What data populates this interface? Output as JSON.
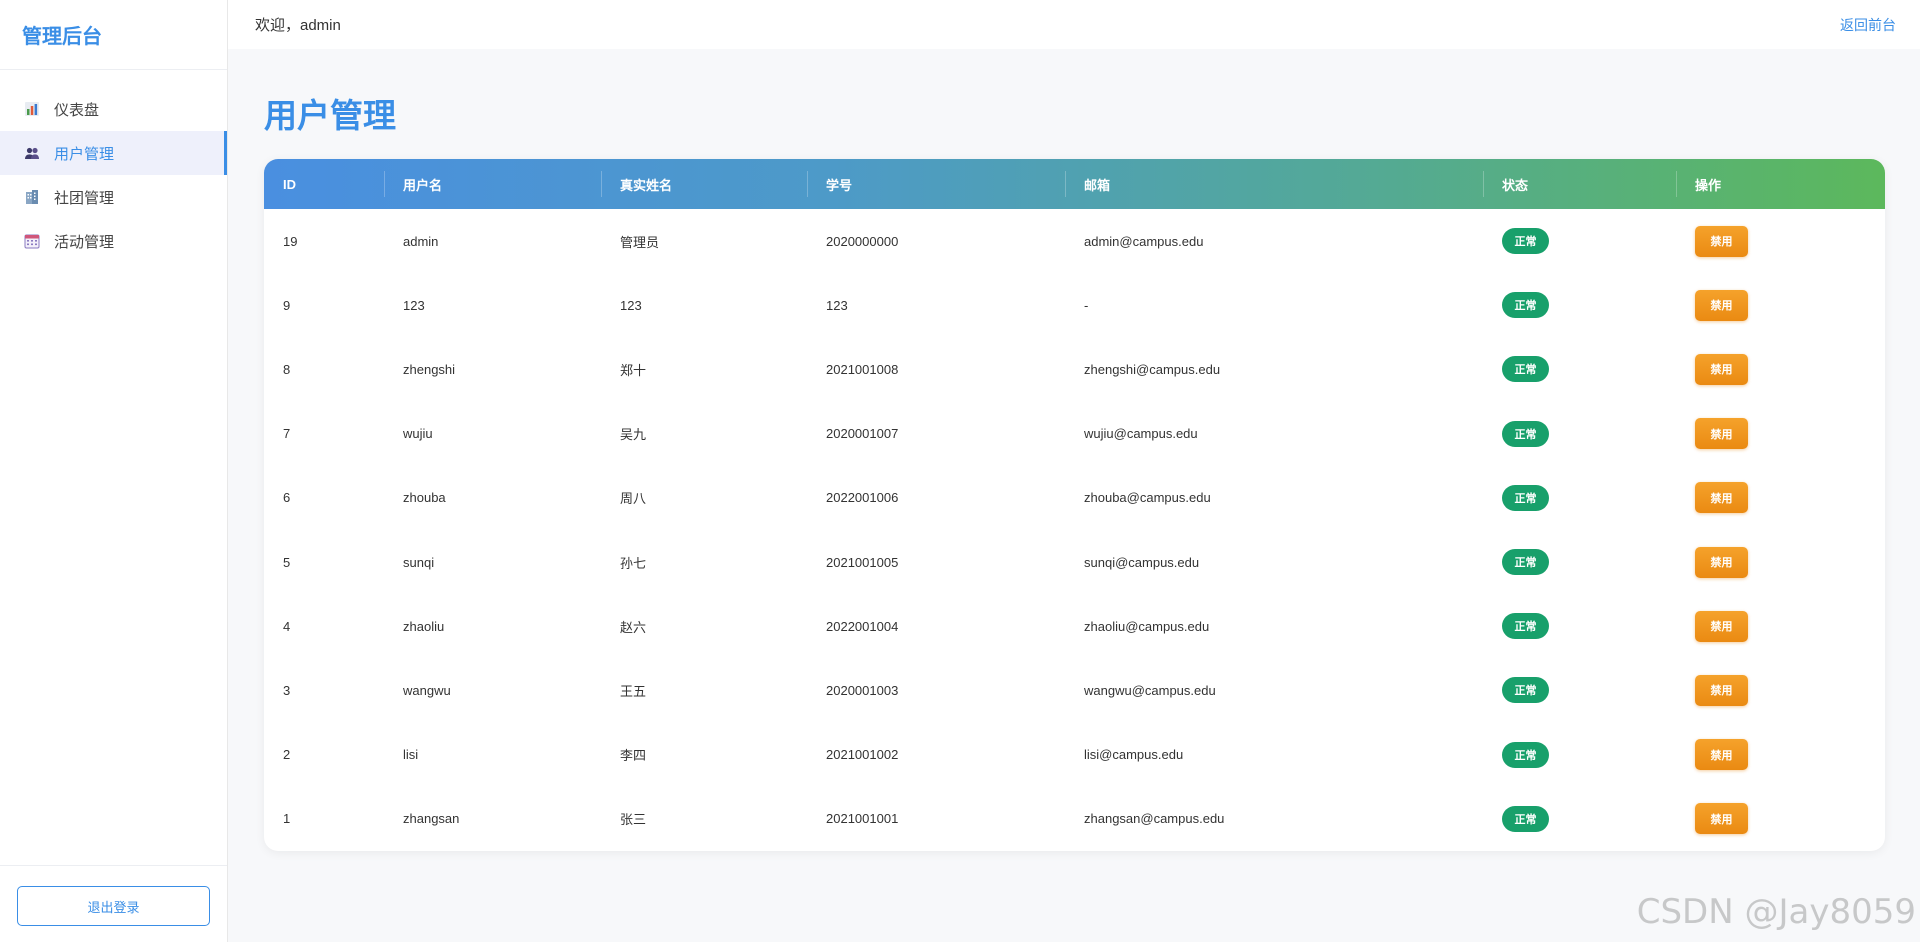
{
  "sidebar": {
    "brand": "管理后台",
    "items": [
      {
        "label": "仪表盘",
        "icon": "bar-chart-icon",
        "active": false
      },
      {
        "label": "用户管理",
        "icon": "users-icon",
        "active": true
      },
      {
        "label": "社团管理",
        "icon": "building-icon",
        "active": false
      },
      {
        "label": "活动管理",
        "icon": "calendar-icon",
        "active": false
      }
    ],
    "logout_label": "退出登录"
  },
  "header": {
    "welcome": "欢迎，admin",
    "back_link": "返回前台"
  },
  "main": {
    "title": "用户管理",
    "table": {
      "headers": [
        "ID",
        "用户名",
        "真实姓名",
        "学号",
        "邮箱",
        "状态",
        "操作"
      ],
      "rows": [
        {
          "id": "19",
          "username": "admin",
          "real_name": "管理员",
          "student_no": "2020000000",
          "email": "admin@campus.edu",
          "status": "正常",
          "action": "禁用"
        },
        {
          "id": "9",
          "username": "123",
          "real_name": "123",
          "student_no": "123",
          "email": "-",
          "status": "正常",
          "action": "禁用"
        },
        {
          "id": "8",
          "username": "zhengshi",
          "real_name": "郑十",
          "student_no": "2021001008",
          "email": "zhengshi@campus.edu",
          "status": "正常",
          "action": "禁用"
        },
        {
          "id": "7",
          "username": "wujiu",
          "real_name": "吴九",
          "student_no": "2020001007",
          "email": "wujiu@campus.edu",
          "status": "正常",
          "action": "禁用"
        },
        {
          "id": "6",
          "username": "zhouba",
          "real_name": "周八",
          "student_no": "2022001006",
          "email": "zhouba@campus.edu",
          "status": "正常",
          "action": "禁用"
        },
        {
          "id": "5",
          "username": "sunqi",
          "real_name": "孙七",
          "student_no": "2021001005",
          "email": "sunqi@campus.edu",
          "status": "正常",
          "action": "禁用"
        },
        {
          "id": "4",
          "username": "zhaoliu",
          "real_name": "赵六",
          "student_no": "2022001004",
          "email": "zhaoliu@campus.edu",
          "status": "正常",
          "action": "禁用"
        },
        {
          "id": "3",
          "username": "wangwu",
          "real_name": "王五",
          "student_no": "2020001003",
          "email": "wangwu@campus.edu",
          "status": "正常",
          "action": "禁用"
        },
        {
          "id": "2",
          "username": "lisi",
          "real_name": "李四",
          "student_no": "2021001002",
          "email": "lisi@campus.edu",
          "status": "正常",
          "action": "禁用"
        },
        {
          "id": "1",
          "username": "zhangsan",
          "real_name": "张三",
          "student_no": "2021001001",
          "email": "zhangsan@campus.edu",
          "status": "正常",
          "action": "禁用"
        }
      ]
    }
  },
  "watermark": "CSDN @Jay8059",
  "colors": {
    "accent": "#3a8ee6",
    "status_ok": "#18a06b",
    "disable_button": "#f09a1f"
  }
}
